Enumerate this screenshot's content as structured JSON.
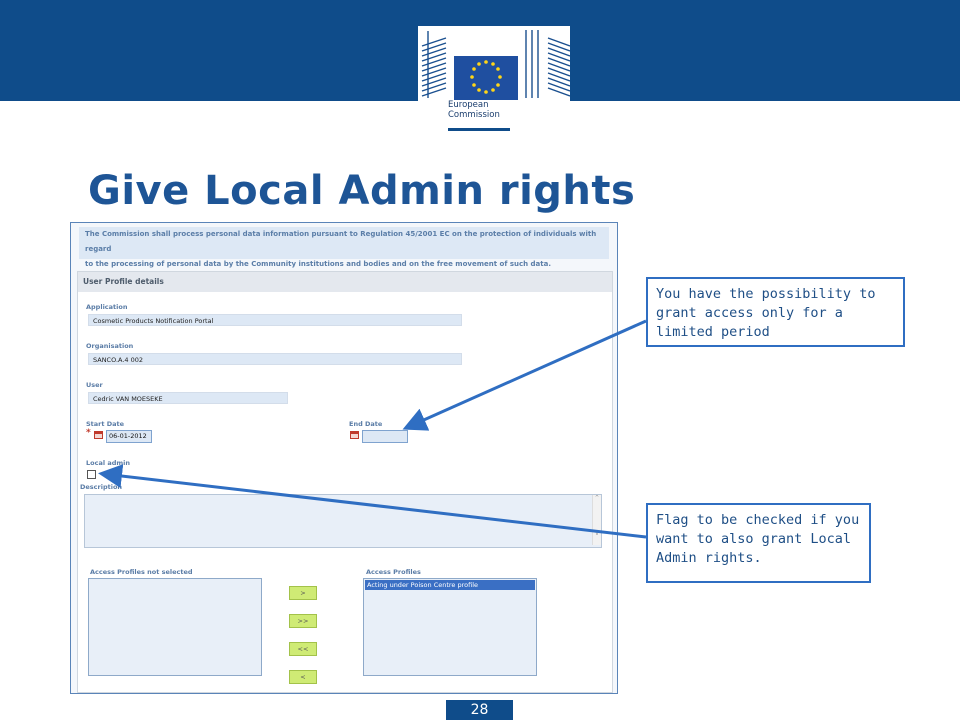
{
  "header": {
    "logo_text_line1": "European",
    "logo_text_line2": "Commission",
    "brand_color": "#0f4c8a"
  },
  "slide": {
    "title": "Give Local Admin rights",
    "page_number": "28"
  },
  "form": {
    "notice_line1": "The Commission shall process personal data information pursuant to Regulation 45/2001 EC on the protection of individuals with regard",
    "notice_line2": "to the processing of personal data by the Community institutions and bodies and on the free movement of such data.",
    "panel_title": "User Profile details",
    "application_label": "Application",
    "application_value": "Cosmetic Products Notification Portal",
    "organisation_label": "Organisation",
    "organisation_value": "SANCO.A.4 002",
    "user_label": "User",
    "user_value": "Cedric VAN MOESEKE",
    "start_date_label": "Start Date",
    "start_date_value": "06-01-2012",
    "end_date_label": "End Date",
    "end_date_value": "",
    "required_marker": "*",
    "local_admin_label": "Local admin",
    "local_admin_checked": false,
    "description_label": "Description",
    "description_value": "",
    "access_not_selected_label": "Access Profiles not selected",
    "access_profiles_label": "Access Profiles",
    "access_profiles_items": [
      "Acting under Poison Centre profile"
    ],
    "buttons": {
      "add": ">",
      "add_all": ">>",
      "remove_all": "<<",
      "remove": "<"
    },
    "scroll_up": "^",
    "scroll_down": "v"
  },
  "callouts": {
    "end_date_note": "You have the possibility to grant access only for a limited period",
    "local_admin_note": "Flag to be checked if you want to also grant Local Admin rights."
  },
  "icons": {
    "calendar": "calendar-icon",
    "logo": "european-commission-logo"
  }
}
